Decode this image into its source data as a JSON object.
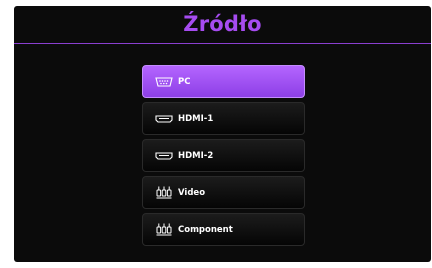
{
  "menu": {
    "title": "Źródło",
    "accent_color": "#a64cf0",
    "selected_index": 0,
    "items": [
      {
        "label": "PC",
        "icon": "vga-port-icon"
      },
      {
        "label": "HDMI-1",
        "icon": "hdmi-port-icon"
      },
      {
        "label": "HDMI-2",
        "icon": "hdmi-port-icon"
      },
      {
        "label": "Video",
        "icon": "rca-connector-icon"
      },
      {
        "label": "Component",
        "icon": "rca-connector-icon"
      }
    ]
  }
}
